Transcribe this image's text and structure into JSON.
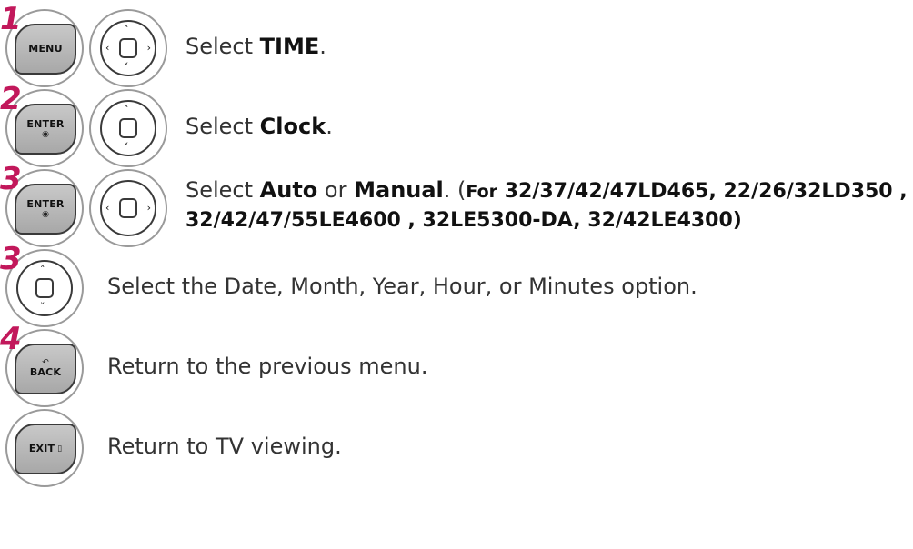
{
  "steps": [
    {
      "number": "1",
      "key_label": "MENU",
      "text_prefix": "Select ",
      "text_bold": "TIME",
      "text_suffix": "."
    },
    {
      "number": "2",
      "key_label": "ENTER",
      "key_sub": "◉",
      "text_prefix": "Select ",
      "text_bold": "Clock",
      "text_suffix": "."
    },
    {
      "number": "3",
      "key_label": "ENTER",
      "key_sub": "◉",
      "text_prefix": "Select ",
      "text_bold": "Auto",
      "text_mid": " or ",
      "text_bold2": "Manual",
      "text_suffix": ". (",
      "models_small": "For",
      "models_line1": " 32/37/42/47LD465, 22/26/32LD350 ,",
      "models_line2": "32/42/47/55LE4600 , 32LE5300-DA, 32/42LE4300)"
    },
    {
      "number": "3",
      "text": "Select the Date, Month, Year, Hour, or Minutes option."
    },
    {
      "number": "4",
      "key_label": "BACK",
      "key_sub": "↶",
      "text": "Return to the previous menu."
    },
    {
      "key_label": "EXIT",
      "key_sub": "▯",
      "text": "Return to TV viewing."
    }
  ],
  "colors": {
    "step_number": "#c2185b",
    "button_fill": "#b0b0b0",
    "outline": "#3a3a3a"
  },
  "icons": [
    "menu-key-icon",
    "enter-key-icon",
    "back-key-icon",
    "exit-key-icon",
    "nav-4way-icon",
    "nav-updown-icon",
    "nav-leftright-icon"
  ]
}
